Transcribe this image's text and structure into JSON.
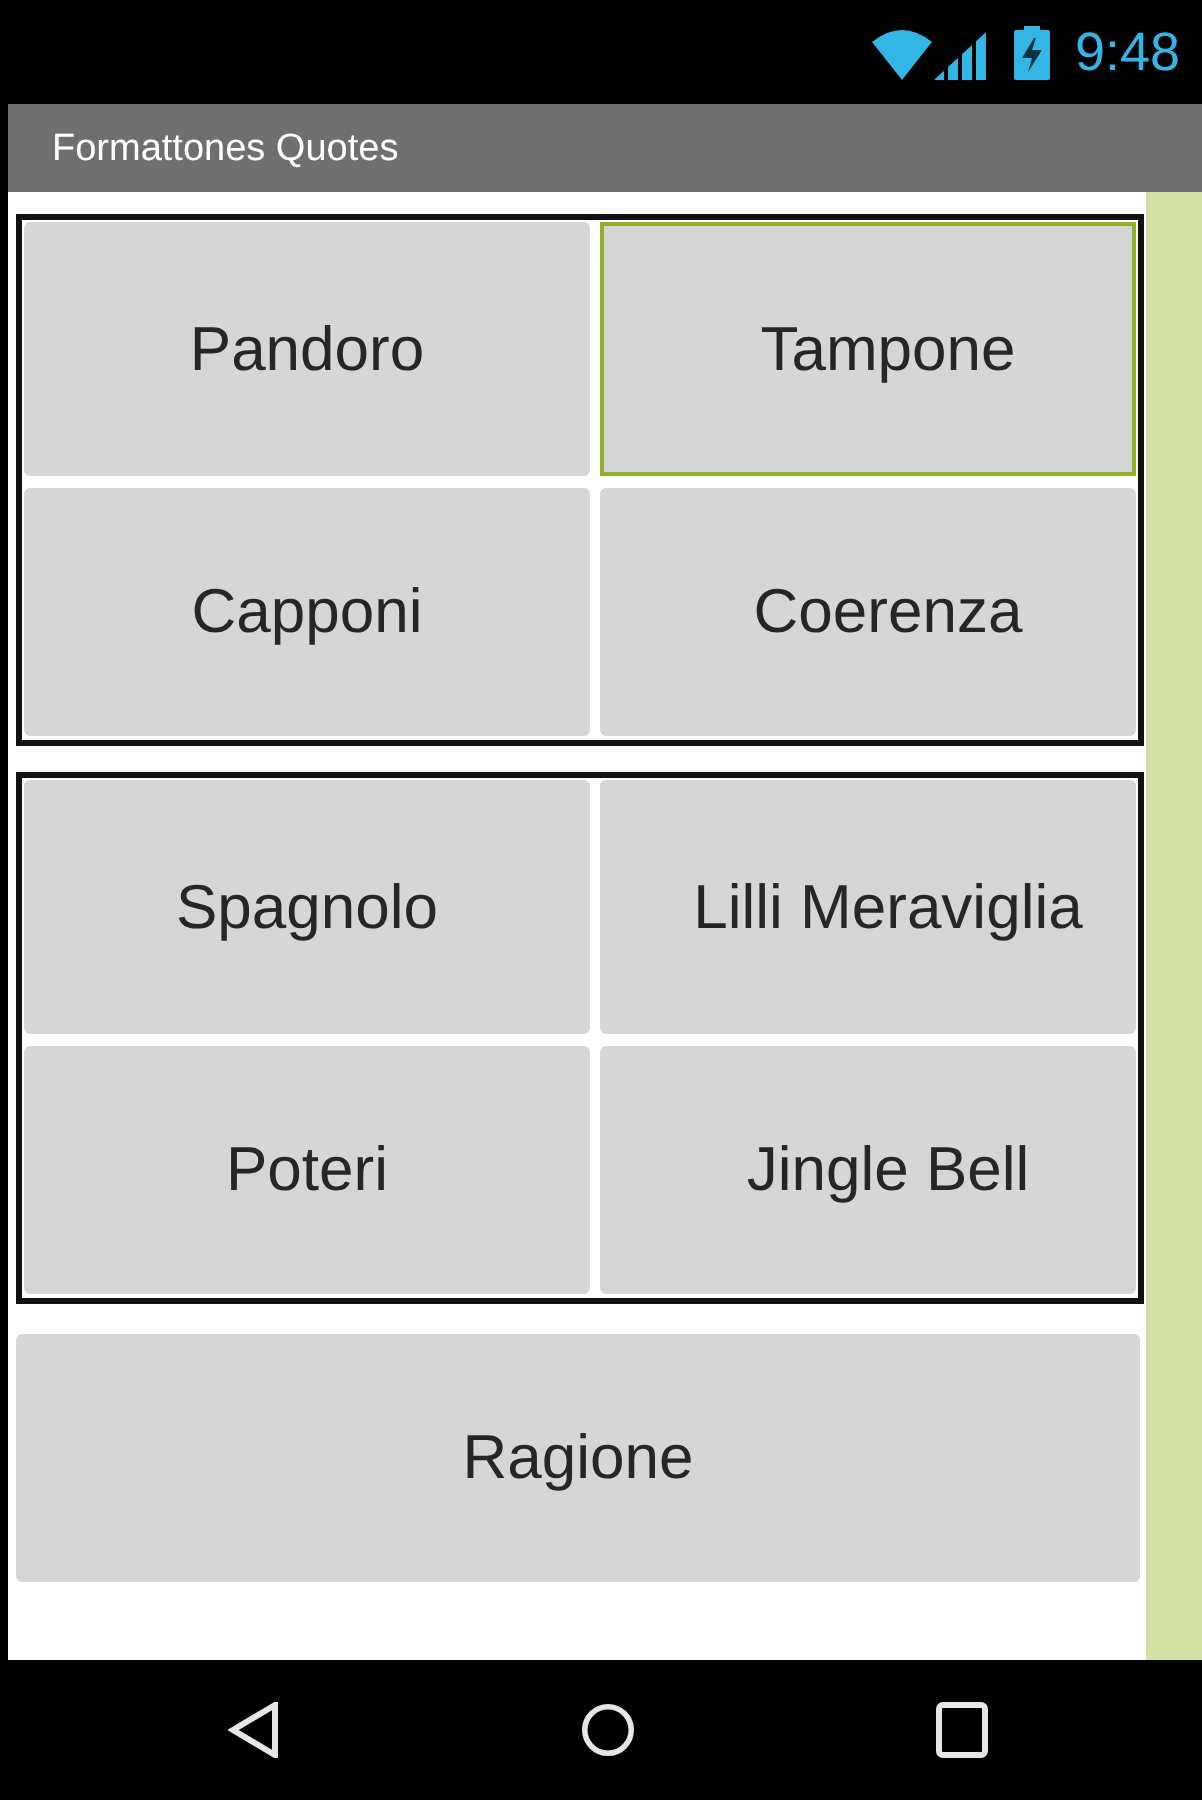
{
  "status_bar": {
    "time": "9:48"
  },
  "title_bar": {
    "title": "Formattones Quotes"
  },
  "button_groups": [
    {
      "buttons": [
        {
          "label": "Pandoro",
          "selected": false
        },
        {
          "label": "Tampone",
          "selected": true
        },
        {
          "label": "Capponi",
          "selected": false
        },
        {
          "label": "Coerenza",
          "selected": false
        }
      ]
    },
    {
      "buttons": [
        {
          "label": "Spagnolo",
          "selected": false
        },
        {
          "label": "Lilli Meraviglia",
          "selected": false
        },
        {
          "label": "Poteri",
          "selected": false
        },
        {
          "label": "Jingle Bell",
          "selected": false
        }
      ]
    }
  ],
  "bottom_button": {
    "label": "Ragione",
    "selected": false
  }
}
